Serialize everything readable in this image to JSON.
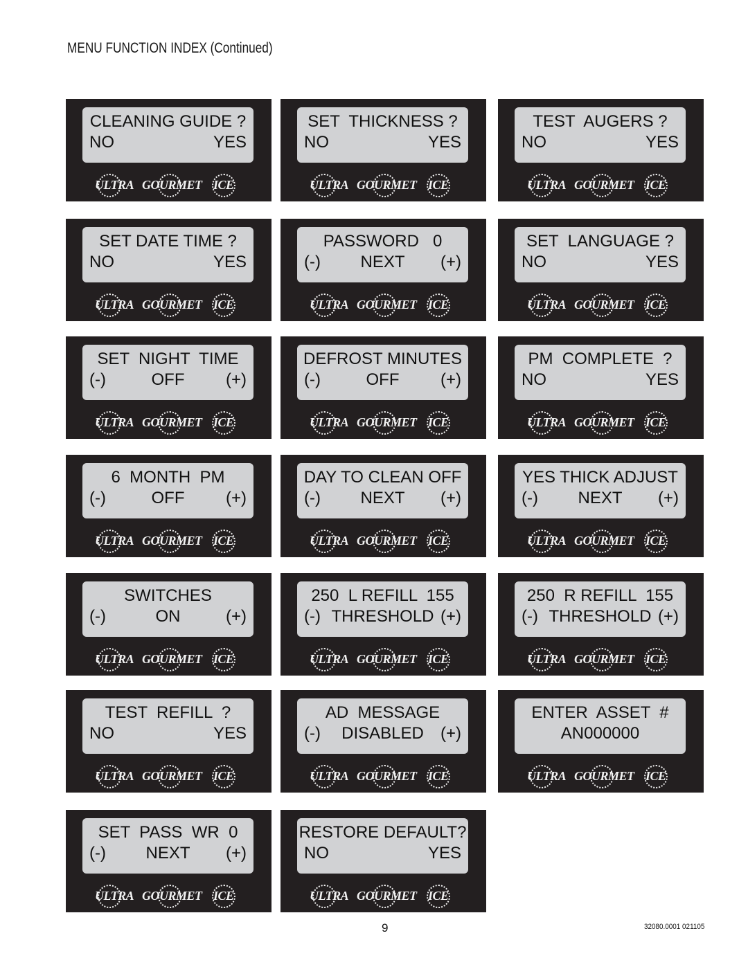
{
  "page": {
    "title": "MENU FUNCTION INDEX (Continued)",
    "page_number": "9",
    "document_code": "32080.0001 021105"
  },
  "brand": {
    "logo_words": [
      "ULTRA",
      "GOURMET",
      "ICE"
    ],
    "panel_color": "#231f20",
    "lcd_color": "#d1d2d4"
  },
  "panels": [
    {
      "line1": "CLEANING GUIDE ?",
      "left": "NO",
      "mid": "",
      "right": "YES"
    },
    {
      "line1": "SET  THICKNESS ?",
      "left": "NO",
      "mid": "",
      "right": "YES"
    },
    {
      "line1": "TEST  AUGERS ?",
      "left": "NO",
      "mid": "",
      "right": "YES"
    },
    {
      "line1": "SET DATE TIME ?",
      "left": "NO",
      "mid": "",
      "right": "YES"
    },
    {
      "line1": "PASSWORD   0",
      "left": "(-)",
      "mid": "NEXT",
      "right": "(+)"
    },
    {
      "line1": "SET  LANGUAGE ?",
      "left": "NO",
      "mid": "",
      "right": "YES"
    },
    {
      "line1": "SET  NIGHT  TIME",
      "left": "(-)",
      "mid": "OFF",
      "right": "(+)"
    },
    {
      "line1": "DEFROST MINUTES",
      "left": "(-)",
      "mid": "OFF",
      "right": "(+)"
    },
    {
      "line1": "PM  COMPLETE  ?",
      "left": "NO",
      "mid": "",
      "right": "YES"
    },
    {
      "line1": "6  MONTH  PM",
      "left": "(-)",
      "mid": "OFF",
      "right": "(+)"
    },
    {
      "line1": "DAY TO CLEAN OFF",
      "left": "(-)",
      "mid": "NEXT",
      "right": "(+)"
    },
    {
      "line1": "YES THICK ADJUST",
      "left": "(-)",
      "mid": "NEXT",
      "right": "(+)"
    },
    {
      "line1": "SWITCHES",
      "left": "(-)",
      "mid": "ON",
      "right": "(+)"
    },
    {
      "line1": "250  L REFILL  155",
      "left": "(-)",
      "mid": "THRESHOLD",
      "right": "(+)"
    },
    {
      "line1": "250  R REFILL  155",
      "left": "(-)",
      "mid": "THRESHOLD",
      "right": "(+)"
    },
    {
      "line1": "TEST  REFILL  ?",
      "left": "NO",
      "mid": "",
      "right": "YES"
    },
    {
      "line1": "AD  MESSAGE",
      "left": "(-)",
      "mid": "DISABLED",
      "right": "(+)"
    },
    {
      "line1": "ENTER  ASSET  #",
      "left": "",
      "mid": "AN000000",
      "right": ""
    },
    {
      "line1": "SET  PASS  WR  0",
      "left": "(-)",
      "mid": "NEXT",
      "right": "(+)"
    },
    {
      "line1": "RESTORE DEFAULT?",
      "left": "NO",
      "mid": "",
      "right": "YES"
    }
  ]
}
